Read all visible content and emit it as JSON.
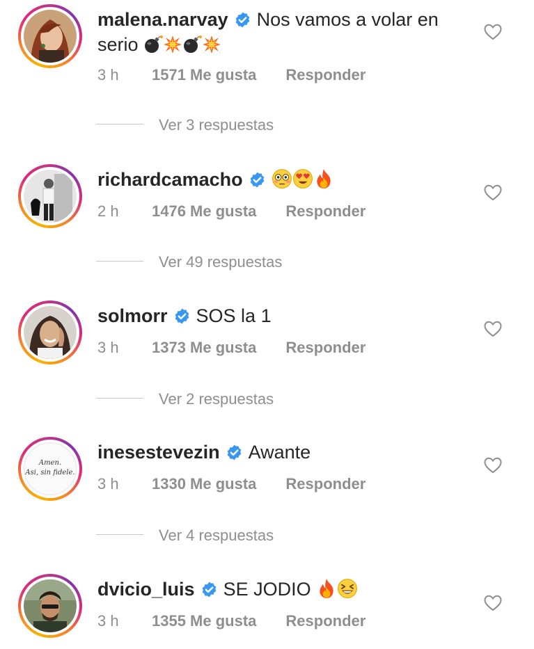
{
  "colors": {
    "text": "#262626",
    "secondary": "#8e8e8e",
    "verified": "#3897f0",
    "ring_start": "#f58529",
    "ring_end": "#dd2a7b"
  },
  "comments": [
    {
      "username": "malena.narvay",
      "text_1": "Nos vamos a volar en",
      "text_2": "serio",
      "emojis": [
        "bomb",
        "collision",
        "bomb",
        "collision"
      ],
      "time": "3 h",
      "likes": "1571 Me gusta",
      "reply": "Responder",
      "replies": "Ver 3 respuestas"
    },
    {
      "username": "richardcamacho",
      "text_1": "",
      "emojis": [
        "flushed-face",
        "heart-eyes-face",
        "fire"
      ],
      "time": "2 h",
      "likes": "1476 Me gusta",
      "reply": "Responder",
      "replies": "Ver 49 respuestas"
    },
    {
      "username": "solmorr",
      "text_1": "SOS la 1",
      "emojis": [],
      "time": "3 h",
      "likes": "1373 Me gusta",
      "reply": "Responder",
      "replies": "Ver 2 respuestas"
    },
    {
      "username": "inesestevezin",
      "text_1": "Awante",
      "emojis": [],
      "time": "3 h",
      "likes": "1330 Me gusta",
      "reply": "Responder",
      "replies": "Ver 4 respuestas",
      "avatar_text_1": "Amen.",
      "avatar_text_2": "Asi, sin fidele."
    },
    {
      "username": "dvicio_luis",
      "text_1": "SE JODIO",
      "emojis": [
        "fire",
        "grinning-squinting-face"
      ],
      "time": "3 h",
      "likes": "1355 Me gusta",
      "reply": "Responder"
    }
  ]
}
